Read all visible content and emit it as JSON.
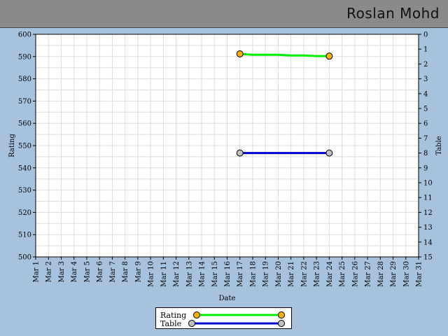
{
  "header": {
    "title": "Roslan Mohd"
  },
  "chart_data": {
    "type": "line",
    "xlabel": "Date",
    "ylabel_left": "Rating",
    "ylabel_right": "Table",
    "x_categories": [
      "Mar 1",
      "Mar 2",
      "Mar 3",
      "Mar 4",
      "Mar 5",
      "Mar 6",
      "Mar 7",
      "Mar 8",
      "Mar 9",
      "Mar 10",
      "Mar 11",
      "Mar 12",
      "Mar 13",
      "Mar 14",
      "Mar 15",
      "Mar 16",
      "Mar 17",
      "Mar 18",
      "Mar 19",
      "Mar 20",
      "Mar 21",
      "Mar 22",
      "Mar 23",
      "Mar 24",
      "Mar 25",
      "Mar 26",
      "Mar 27",
      "Mar 28",
      "Mar 29",
      "Mar 30",
      "Mar 31"
    ],
    "ylim_left": [
      500,
      600
    ],
    "ylim_right": [
      0,
      15
    ],
    "y_ticks_left": [
      600,
      590,
      580,
      570,
      560,
      550,
      540,
      530,
      520,
      510,
      500
    ],
    "y_ticks_right": [
      0,
      1,
      2,
      3,
      4,
      5,
      6,
      7,
      8,
      9,
      10,
      11,
      12,
      13,
      14,
      15
    ],
    "grid": true,
    "legend_placement": "bottom-center",
    "series": [
      {
        "name": "Rating",
        "axis": "left",
        "color": "#00ee00",
        "marker_color": "#ffb000",
        "points": [
          {
            "x": "Mar 17",
            "y": 591.2
          },
          {
            "x": "Mar 18",
            "y": 590.8
          },
          {
            "x": "Mar 19",
            "y": 590.8
          },
          {
            "x": "Mar 20",
            "y": 590.8
          },
          {
            "x": "Mar 21",
            "y": 590.5
          },
          {
            "x": "Mar 22",
            "y": 590.5
          },
          {
            "x": "Mar 23",
            "y": 590.2
          },
          {
            "x": "Mar 24",
            "y": 590.2
          }
        ]
      },
      {
        "name": "Table",
        "axis": "right",
        "color": "#0000cc",
        "marker_color": "#c0c0c0",
        "points": [
          {
            "x": "Mar 17",
            "y": 8
          },
          {
            "x": "Mar 24",
            "y": 8
          }
        ]
      }
    ]
  },
  "legend": {
    "rating": "Rating",
    "table": "Table"
  }
}
